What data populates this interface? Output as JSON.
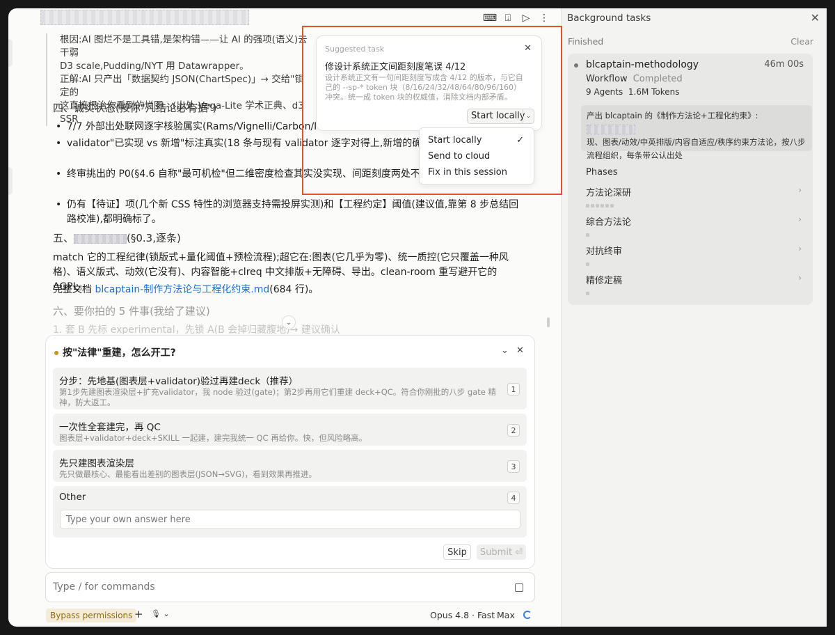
{
  "conversation": {
    "quote_lines": [
      "根因:AI 图烂不是工具错,是架构错——让 AI 的强项(语义)去干弱",
      "D3 scale,Pudding/NYT 用 Datawrapper。",
      "正解:AI 只产出「数据契约 JSON(ChartSpec)」→ 交给\"锁定的",
      "这直接根治你看到的烂图。(出处:Vega-Lite 学术正典、d3 SSR"
    ],
    "section4_heading": "四、诚实状态(按你\"凡结论必有据\")",
    "bullets": [
      "7/7 外部出处联网逐字核验属实(Rams/Vignelli/Carbon/Mant",
      "validator\"已实现 vs 新增\"标注真实(18 条与现有 validator 逐字对得上,新增的确实还没实现套\")。",
      "终审挑出的 P0(§4.6 自称\"最可机检\"但二维密度检查其实没实现、间距刻度两处不一致注。",
      "仍有【待证】项(几个新 CSS 特性的浏览器支持需投屏实测)和【工程约定】阈值(建议值,靠第 8 步总结回路校准),都明确标了。"
    ],
    "section5_heading_suffix": "(§0.3,逐条)",
    "section5_prefix": "五、",
    "match_para": "match 它的工程纪律(锁版式+量化阈值+预检流程);超它在:图表(它几乎为零)、统一质控(它只覆盖一种风格)、语义版式、动效(它没有)、内容智能+clreq 中文排版+无障碍、导出。clean-room 重写避开它的 AGPL。",
    "doc_prefix": "完整文档 ",
    "doc_link": "blcaptain-制作方法论与工程化约束.md",
    "doc_suffix": "(684 行)。",
    "section6_heading": "六、要你拍的 5 件事(我给了建议)",
    "faded_line": "1. 套 B 先标 experimental，先锁 A(B 会掉归藏腹地)→ 建议确认"
  },
  "question": {
    "title": "按\"法律\"重建，怎么开工?",
    "options": [
      {
        "title": "分步：先地基(图表层+validator)验过再建deck（推荐）",
        "desc": "第1步先建图表渲染层+扩充validator，我 node 验过(gate)；第2步再用它们重建 deck+QC。符合你刚批的八步 gate 精神，防大返工。",
        "num": "1"
      },
      {
        "title": "一次性全套建完，再 QC",
        "desc": "图表层+validator+deck+SKILL 一起建，建完我统一 QC 再给你。快，但风险略高。",
        "num": "2"
      },
      {
        "title": "先只建图表渲染层",
        "desc": "先只做最核心、最能看出差别的图表层(JSON→SVG)，看到效果再推进。",
        "num": "3"
      },
      {
        "title": "Other",
        "desc": "",
        "num": "4"
      }
    ],
    "own_answer_placeholder": "Type your own answer here",
    "skip_label": "Skip",
    "submit_label": "Submit ⏎"
  },
  "command": {
    "placeholder": "Type / for commands",
    "bypass_label": "Bypass permissions",
    "plus": "+",
    "mic": "🎙 ⌄",
    "model": "Opus 4.8 · Fast",
    "effort": "Max"
  },
  "toolbar": {
    "terminal": "⌨",
    "export": "⍗",
    "run": "▷",
    "more": "⋮"
  },
  "suggested_task": {
    "label": "Suggested task",
    "title": "修设计系统正文间距刻度笔误 4/12",
    "desc": "设计系统正文有一句间距刻度写成含 4/12 的版本，与它自己的 --sp-* token 块（8/16/24/32/48/64/80/96/160）冲突。统一成 token 块的权威值，消除文档内部矛盾。",
    "start_label": "Start locally",
    "menu": [
      "Start locally",
      "Send to cloud",
      "Fix in this session"
    ],
    "selected": "Start locally"
  },
  "background_tasks": {
    "title": "Background tasks",
    "finished_label": "Finished",
    "clear_label": "Clear",
    "task": {
      "name": "blcaptain-methodology",
      "time": "46m 00s",
      "type": "Workflow",
      "status": "Completed",
      "agents": "9 Agents",
      "tokens": "1.6M Tokens",
      "desc_prefix": "产出 blcaptain 的《制作方法论+工程化约束》:",
      "desc_rest": "现、图表/动效/中英排版/内容自适应/秩序约束方法论，按八步流程组织，每条带公认出处"
    },
    "phases_heading": "Phases",
    "phases": [
      {
        "name": "方法论深研",
        "dots": 6
      },
      {
        "name": "综合方法论",
        "dots": 1
      },
      {
        "name": "对抗终审",
        "dots": 1
      },
      {
        "name": "精修定稿",
        "dots": 1
      }
    ]
  }
}
